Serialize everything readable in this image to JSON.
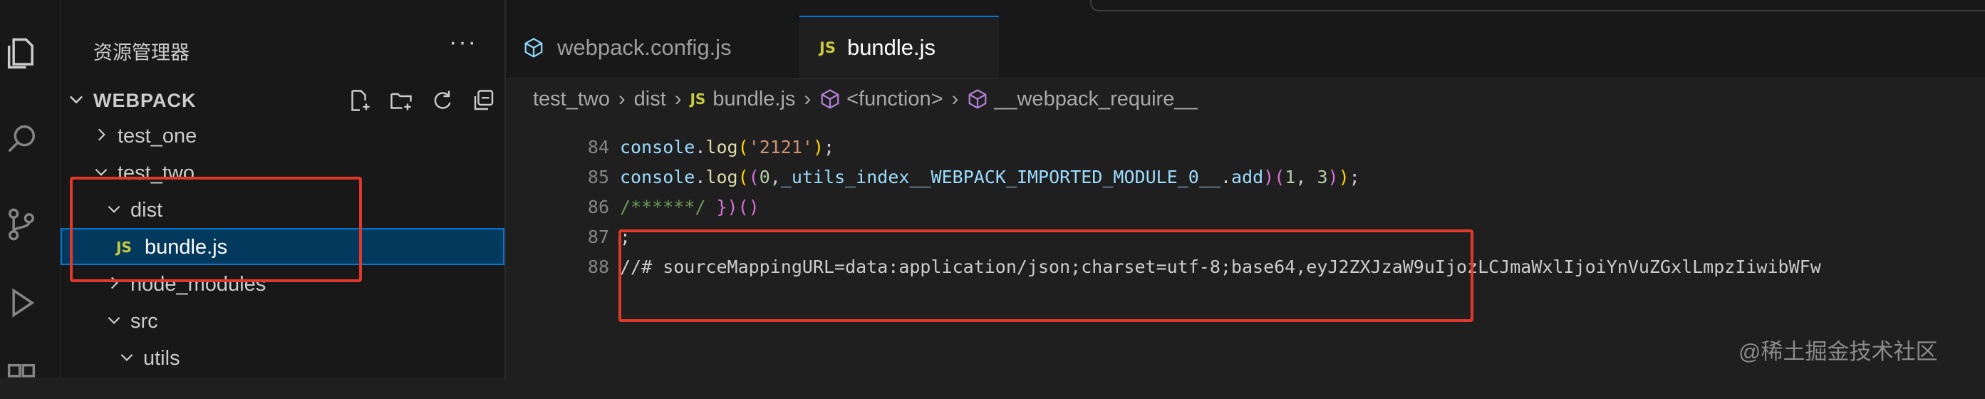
{
  "activity_bar": {
    "items": [
      {
        "name": "explorer-icon"
      },
      {
        "name": "search-icon"
      },
      {
        "name": "source-control-icon"
      },
      {
        "name": "run-debug-icon"
      },
      {
        "name": "extensions-icon"
      }
    ]
  },
  "sidebar": {
    "title": "资源管理器",
    "more": "···",
    "section_title": "WEBPACK",
    "tree": [
      {
        "label": "test_one",
        "indent": 1,
        "kind": "folder",
        "expanded": false
      },
      {
        "label": "test_two",
        "indent": 1,
        "kind": "folder",
        "expanded": true
      },
      {
        "label": "dist",
        "indent": 2,
        "kind": "folder",
        "expanded": true
      },
      {
        "label": "bundle.js",
        "indent": 3,
        "kind": "file",
        "badge": "JS",
        "selected": true
      },
      {
        "label": "node_modules",
        "indent": 2,
        "kind": "folder",
        "expanded": false
      },
      {
        "label": "src",
        "indent": 2,
        "kind": "folder",
        "expanded": true
      },
      {
        "label": "utils",
        "indent": 3,
        "kind": "folder",
        "expanded": true
      }
    ]
  },
  "tabs": [
    {
      "label": "webpack.config.js",
      "active": false
    },
    {
      "label": "bundle.js",
      "badge": "JS",
      "active": true
    }
  ],
  "breadcrumb": {
    "parts": [
      "test_two",
      "dist",
      "bundle.js",
      "<function>",
      "__webpack_require__"
    ]
  },
  "editor": {
    "lines": [
      {
        "num": "84",
        "text": "console.log('2121');"
      },
      {
        "num": "85",
        "text": "console.log((0,_utils_index__WEBPACK_IMPORTED_MODULE_0__.add)(1, 3));"
      },
      {
        "num": "86",
        "text": "/******/ })()"
      },
      {
        "num": "87",
        "text": ";"
      },
      {
        "num": "88",
        "text": "//# sourceMappingURL=data:application/json;charset=utf-8;base64,eyJ2ZXJzaW9uIjozLCJmaWxlIjoiYnVuZGxlLmpzIiwibWFw"
      }
    ]
  },
  "watermark": "@稀土掘金技术社区",
  "colors": {
    "accent": "#0078d4",
    "highlight_box": "#e0382b",
    "js_badge": "#cbcb41"
  }
}
